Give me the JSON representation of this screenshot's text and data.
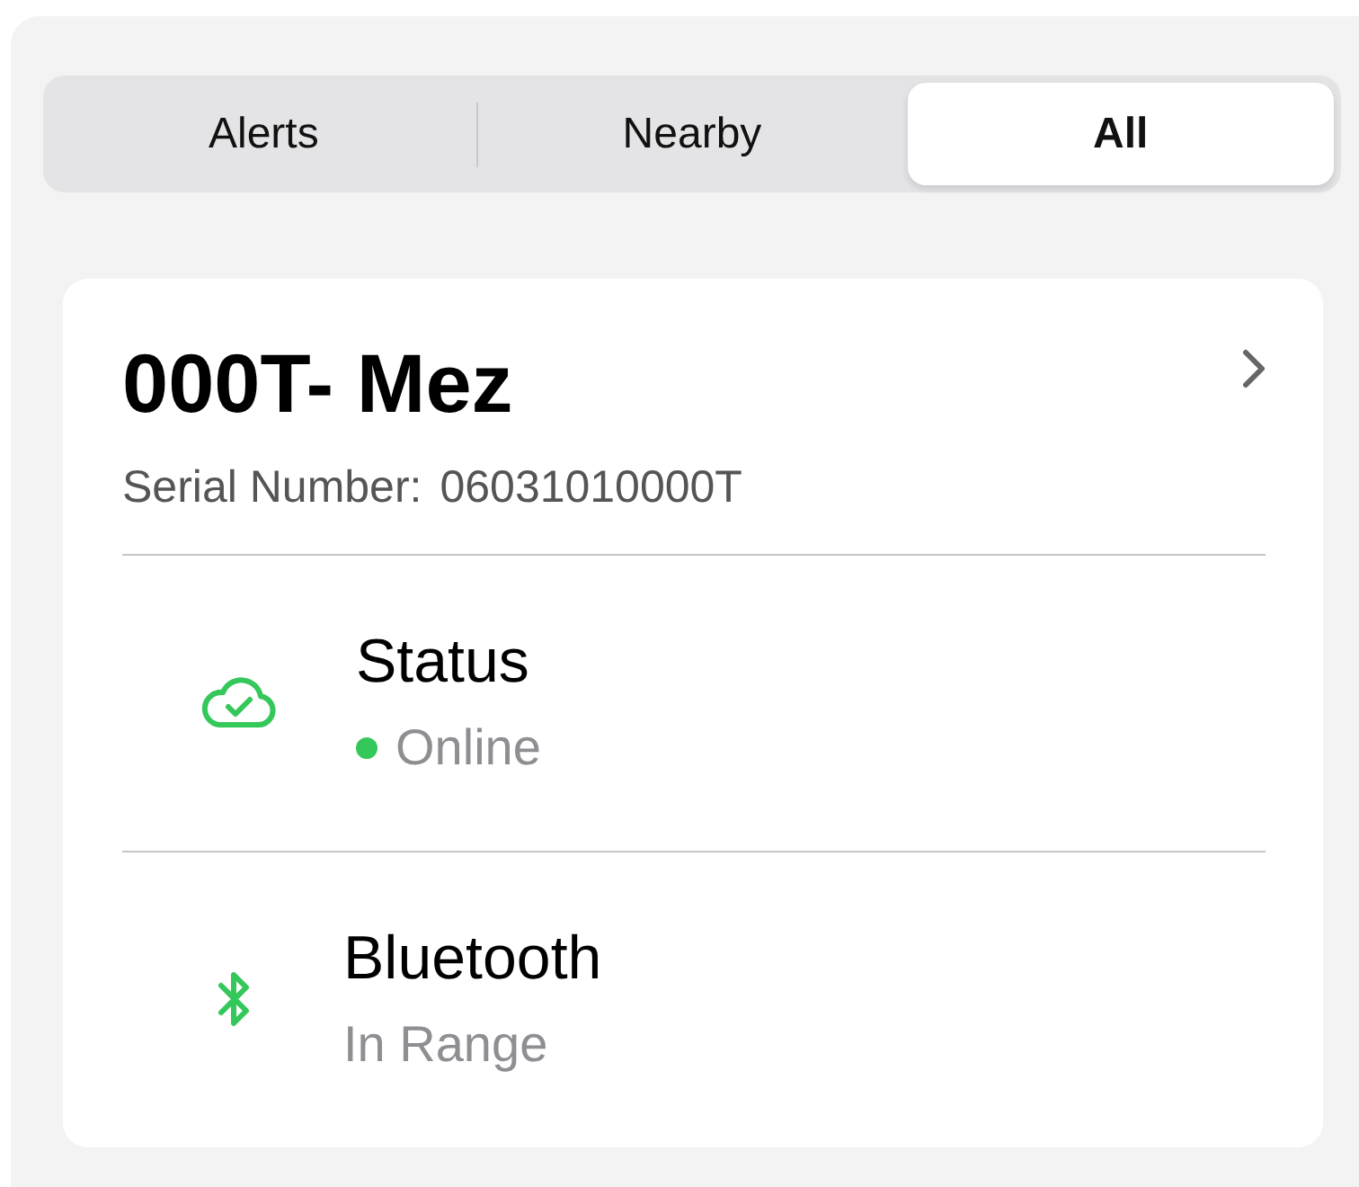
{
  "tabs": [
    {
      "label": "Alerts",
      "selected": false
    },
    {
      "label": "Nearby",
      "selected": false
    },
    {
      "label": "All",
      "selected": true
    }
  ],
  "device": {
    "name": "000T- Mez",
    "serial_label": "Serial Number:",
    "serial": "06031010000T",
    "rows": [
      {
        "kind": "cloud",
        "label": "Status",
        "value": "Online",
        "color": "#34c759"
      },
      {
        "kind": "bluetooth",
        "label": "Bluetooth",
        "value": "In Range"
      }
    ]
  }
}
